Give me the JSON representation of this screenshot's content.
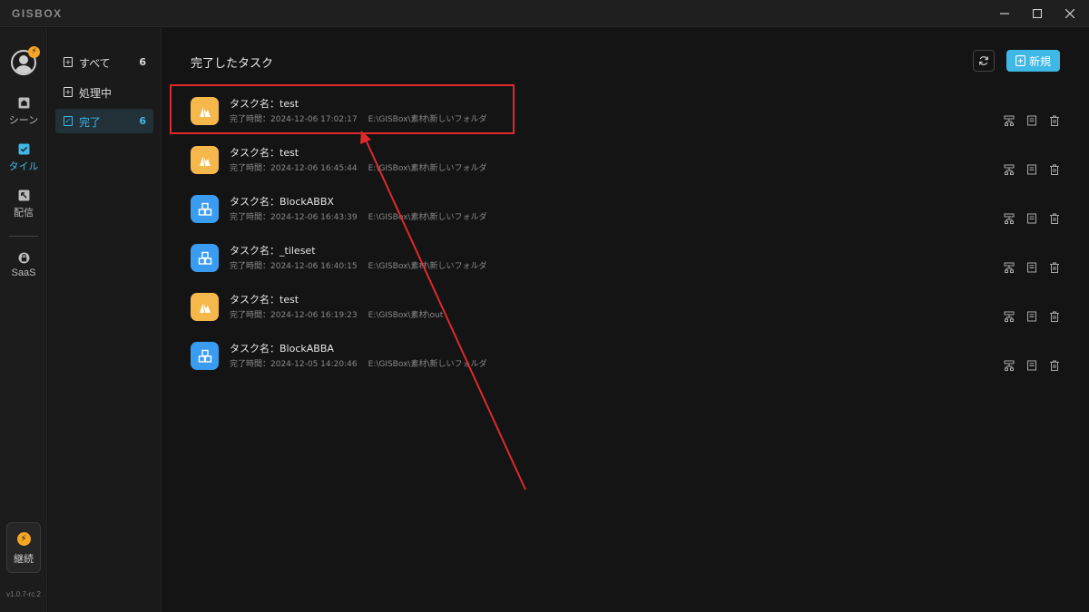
{
  "app": {
    "logo": "GISBOX",
    "version": "v1.0.7-rc.2",
    "avatar_badge": "⚡"
  },
  "rail": {
    "items": [
      {
        "label": "シーン",
        "icon": "scene-icon"
      },
      {
        "label": "タイル",
        "icon": "tile-icon",
        "active": true
      },
      {
        "label": "配信",
        "icon": "publish-icon"
      },
      {
        "label": "SaaS",
        "icon": "saas-lock-icon"
      }
    ],
    "continue_label": "継続"
  },
  "sidebar": {
    "items": [
      {
        "label": "すべて",
        "count": "6"
      },
      {
        "label": "処理中",
        "count": ""
      },
      {
        "label": "完了",
        "count": "6",
        "active": true
      }
    ]
  },
  "main": {
    "title": "完了したタスク",
    "new_button": "新規",
    "tasks": [
      {
        "name": "タスク名：test",
        "time": "完了時間：2024-12-06 17:02:17",
        "path": "E:\\GISBox\\素材\\新しいフォルダ",
        "type": "orange"
      },
      {
        "name": "タスク名：test",
        "time": "完了時間：2024-12-06 16:45:44",
        "path": "E:\\GISBox\\素材\\新しいフォルダ",
        "type": "orange"
      },
      {
        "name": "タスク名：BlockABBX",
        "time": "完了時間：2024-12-06 16:43:39",
        "path": "E:\\GISBox\\素材\\新しいフォルダ",
        "type": "blue"
      },
      {
        "name": "タスク名：_tileset",
        "time": "完了時間：2024-12-06 16:40:15",
        "path": "E:\\GISBox\\素材\\新しいフォルダ",
        "type": "blue"
      },
      {
        "name": "タスク名：test",
        "time": "完了時間：2024-12-06 16:19:23",
        "path": "E:\\GISBox\\素材\\out",
        "type": "orange"
      },
      {
        "name": "タスク名：BlockABBA",
        "time": "完了時間：2024-12-05 14:20:46",
        "path": "E:\\GISBox\\素材\\新しいフォルダ",
        "type": "blue"
      }
    ]
  },
  "colors": {
    "accent": "#3fb8e6",
    "highlight": "#e0292b",
    "orange_icon": "#f6b84a",
    "blue_icon": "#3a9cf0"
  }
}
